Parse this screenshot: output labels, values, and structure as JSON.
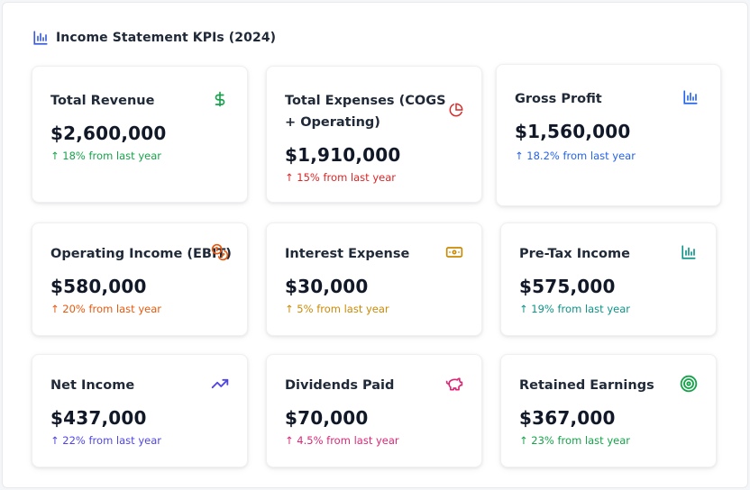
{
  "header": {
    "title": "Income Statement KPIs (2024)",
    "icon": "bar-chart-icon",
    "icon_color": "#3b5bdb"
  },
  "cards": [
    {
      "title": "Total Revenue",
      "value": "$2,600,000",
      "change": "↑ 18% from last year",
      "color": "#16a34a",
      "icon": "dollar-icon"
    },
    {
      "title": "Total Expenses (COGS + Operating)",
      "value": "$1,910,000",
      "change": "↑ 15% from last year",
      "color": "#dc2626",
      "icon": "pie-chart-icon"
    },
    {
      "title": "Gross Profit",
      "value": "$1,560,000",
      "change": "↑ 18.2% from last year",
      "color": "#2563eb",
      "icon": "bar-chart-icon"
    },
    {
      "title": "Operating Income (EBIT)",
      "value": "$580,000",
      "change": "↑ 20% from last year",
      "color": "#ea580c",
      "icon": "coins-icon"
    },
    {
      "title": "Interest Expense",
      "value": "$30,000",
      "change": "↑ 5% from last year",
      "color": "#ca8a04",
      "icon": "banknote-icon"
    },
    {
      "title": "Pre-Tax Income",
      "value": "$575,000",
      "change": "↑ 19% from last year",
      "color": "#0d9488",
      "icon": "bar-chart-icon"
    },
    {
      "title": "Net Income",
      "value": "$437,000",
      "change": "↑ 22% from last year",
      "color": "#4f46e5",
      "icon": "trending-up-icon"
    },
    {
      "title": "Dividends Paid",
      "value": "$70,000",
      "change": "↑ 4.5% from last year",
      "color": "#db2777",
      "icon": "piggy-bank-icon"
    },
    {
      "title": "Retained Earnings",
      "value": "$367,000",
      "change": "↑ 23% from last year",
      "color": "#16a34a",
      "icon": "target-icon"
    }
  ]
}
